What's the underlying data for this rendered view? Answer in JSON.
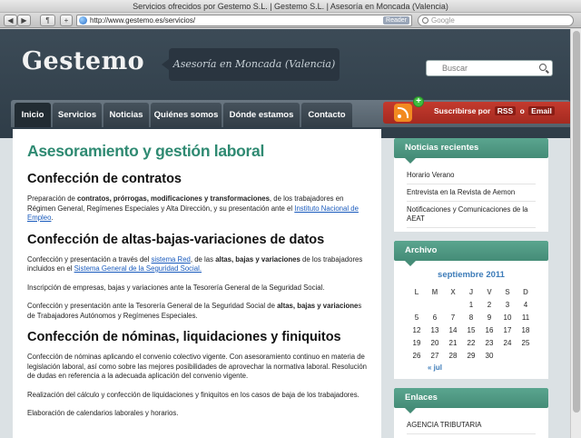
{
  "browser": {
    "title": "Servicios ofrecidos por Gestemo S.L. | Gestemo S.L. | Asesoría en Moncada (Valencia)",
    "url": "http://www.gestemo.es/servicios/",
    "reader_label": "Reader",
    "search_placeholder": "Google",
    "buttons": {
      "back": "◀",
      "forward": "▶",
      "bookmarks": "📖",
      "add": "+"
    }
  },
  "header": {
    "logo": "Gestemo",
    "tagline": "Asesoría en Moncada (Valencia)",
    "search_placeholder": "Buscar"
  },
  "nav": {
    "items": [
      "Inicio",
      "Servicios",
      "Noticias",
      "Quiénes somos",
      "Dónde estamos",
      "Contacto"
    ],
    "active": "Inicio"
  },
  "subscribe": {
    "prefix": "Suscribirse por",
    "rss": "RSS",
    "o": "o",
    "email": "Email"
  },
  "main": {
    "title": "Asesoramiento y gestión laboral",
    "s1_title": "Confección de contratos",
    "s1_p1_a": "Preparación de ",
    "s1_p1_b": "contratos, prórrogas, modificaciones y transformaciones",
    "s1_p1_c": ", de los trabajadores en Régimen General, Regímenes Especiales y Alta Dirección, y su presentación ante el ",
    "s1_p1_link": "Instituto Nacional de Empleo",
    "s1_p1_d": ".",
    "s2_title": "Confección de altas-bajas-variaciones de datos",
    "s2_p1_a": "Confección y presentación a través del ",
    "s2_p1_link1": "sistema Red",
    "s2_p1_b": ", de las ",
    "s2_p1_c": "altas, bajas y variaciones",
    "s2_p1_d": " de los trabajadores incluidos en el ",
    "s2_p1_link2": "Sistema General de la Seguridad Social.",
    "s2_p2": "Inscripción de empresas, bajas y variaciones ante la Tesorería General de la Seguridad Social.",
    "s2_p3_a": "Confección y presentación ante la Tesorería General de la Seguridad Social de ",
    "s2_p3_b": "altas, bajas y variacione",
    "s2_p3_c": "s de Trabajadores Autónomos y Regímenes Especiales.",
    "s3_title": "Confección de nóminas, liquidaciones y finiquitos",
    "s3_p1": "Confección de nóminas aplicando el convenio colectivo vigente. Con asesoramiento continuo en materia de legislación laboral, así como sobre las mejores posibilidades de aprovechar la normativa laboral. Resolución de dudas en referencia a la adecuada aplicación del convenio vigente.",
    "s3_p2": "Realización del cálculo y confección de liquidaciones y finiquitos en los casos de baja de los trabajadores.",
    "s3_p3": "Elaboración de calendarios laborales y horarios."
  },
  "sidebar": {
    "news_title": "Noticias recientes",
    "news": [
      "Horario Verano",
      "Entrevista en la Revista de Aemon",
      "Notificaciones y Comunicaciones de la AEAT"
    ],
    "archive_title": "Archivo",
    "month": "septiembre 2011",
    "weekdays": [
      "L",
      "M",
      "X",
      "J",
      "V",
      "S",
      "D"
    ],
    "weeks": [
      [
        "",
        "",
        "",
        "1",
        "2",
        "3",
        "4"
      ],
      [
        "5",
        "6",
        "7",
        "8",
        "9",
        "10",
        "11"
      ],
      [
        "12",
        "13",
        "14",
        "15",
        "16",
        "17",
        "18"
      ],
      [
        "19",
        "20",
        "21",
        "22",
        "23",
        "24",
        "25"
      ],
      [
        "26",
        "27",
        "28",
        "29",
        "30",
        "",
        ""
      ]
    ],
    "prev": "« jul",
    "links_title": "Enlaces",
    "links": [
      "AGENCIA TRIBUTARIA"
    ]
  }
}
